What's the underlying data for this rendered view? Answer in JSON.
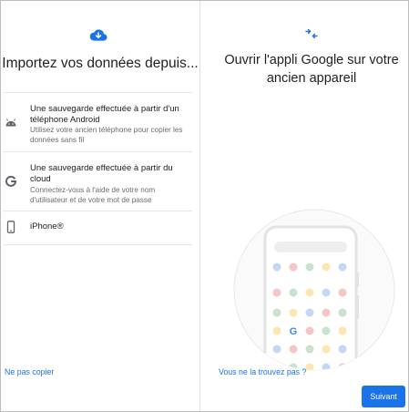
{
  "left_screen": {
    "icon": "cloud-download-icon",
    "heading": "Importez vos données depuis...",
    "options": [
      {
        "icon": "android-icon",
        "title": "Une sauvegarde effectuée à partir d'un téléphone Android",
        "description": "Utilisez votre ancien téléphone pour copier les données sans fil"
      },
      {
        "icon": "google-g-icon",
        "title": "Une sauvegarde effectuée à partir du cloud",
        "description": "Connectez-vous à l'aide de votre nom d'utilisateur et de votre mot de passe"
      },
      {
        "icon": "iphone-icon",
        "title": "iPhone®",
        "description": ""
      }
    ],
    "skip_link": "Ne pas copier"
  },
  "right_screen": {
    "icon": "connect-arrows-icon",
    "heading": "Ouvrir l'appli Google sur votre ancien appareil",
    "help_link": "Vous ne la trouvez pas ?",
    "next_button": "Suivant"
  },
  "colors": {
    "accent": "#1a73e8",
    "dot_colors": [
      "#c5d7f7",
      "#f5c6c3",
      "#c7e3cd",
      "#fde7b0"
    ]
  }
}
